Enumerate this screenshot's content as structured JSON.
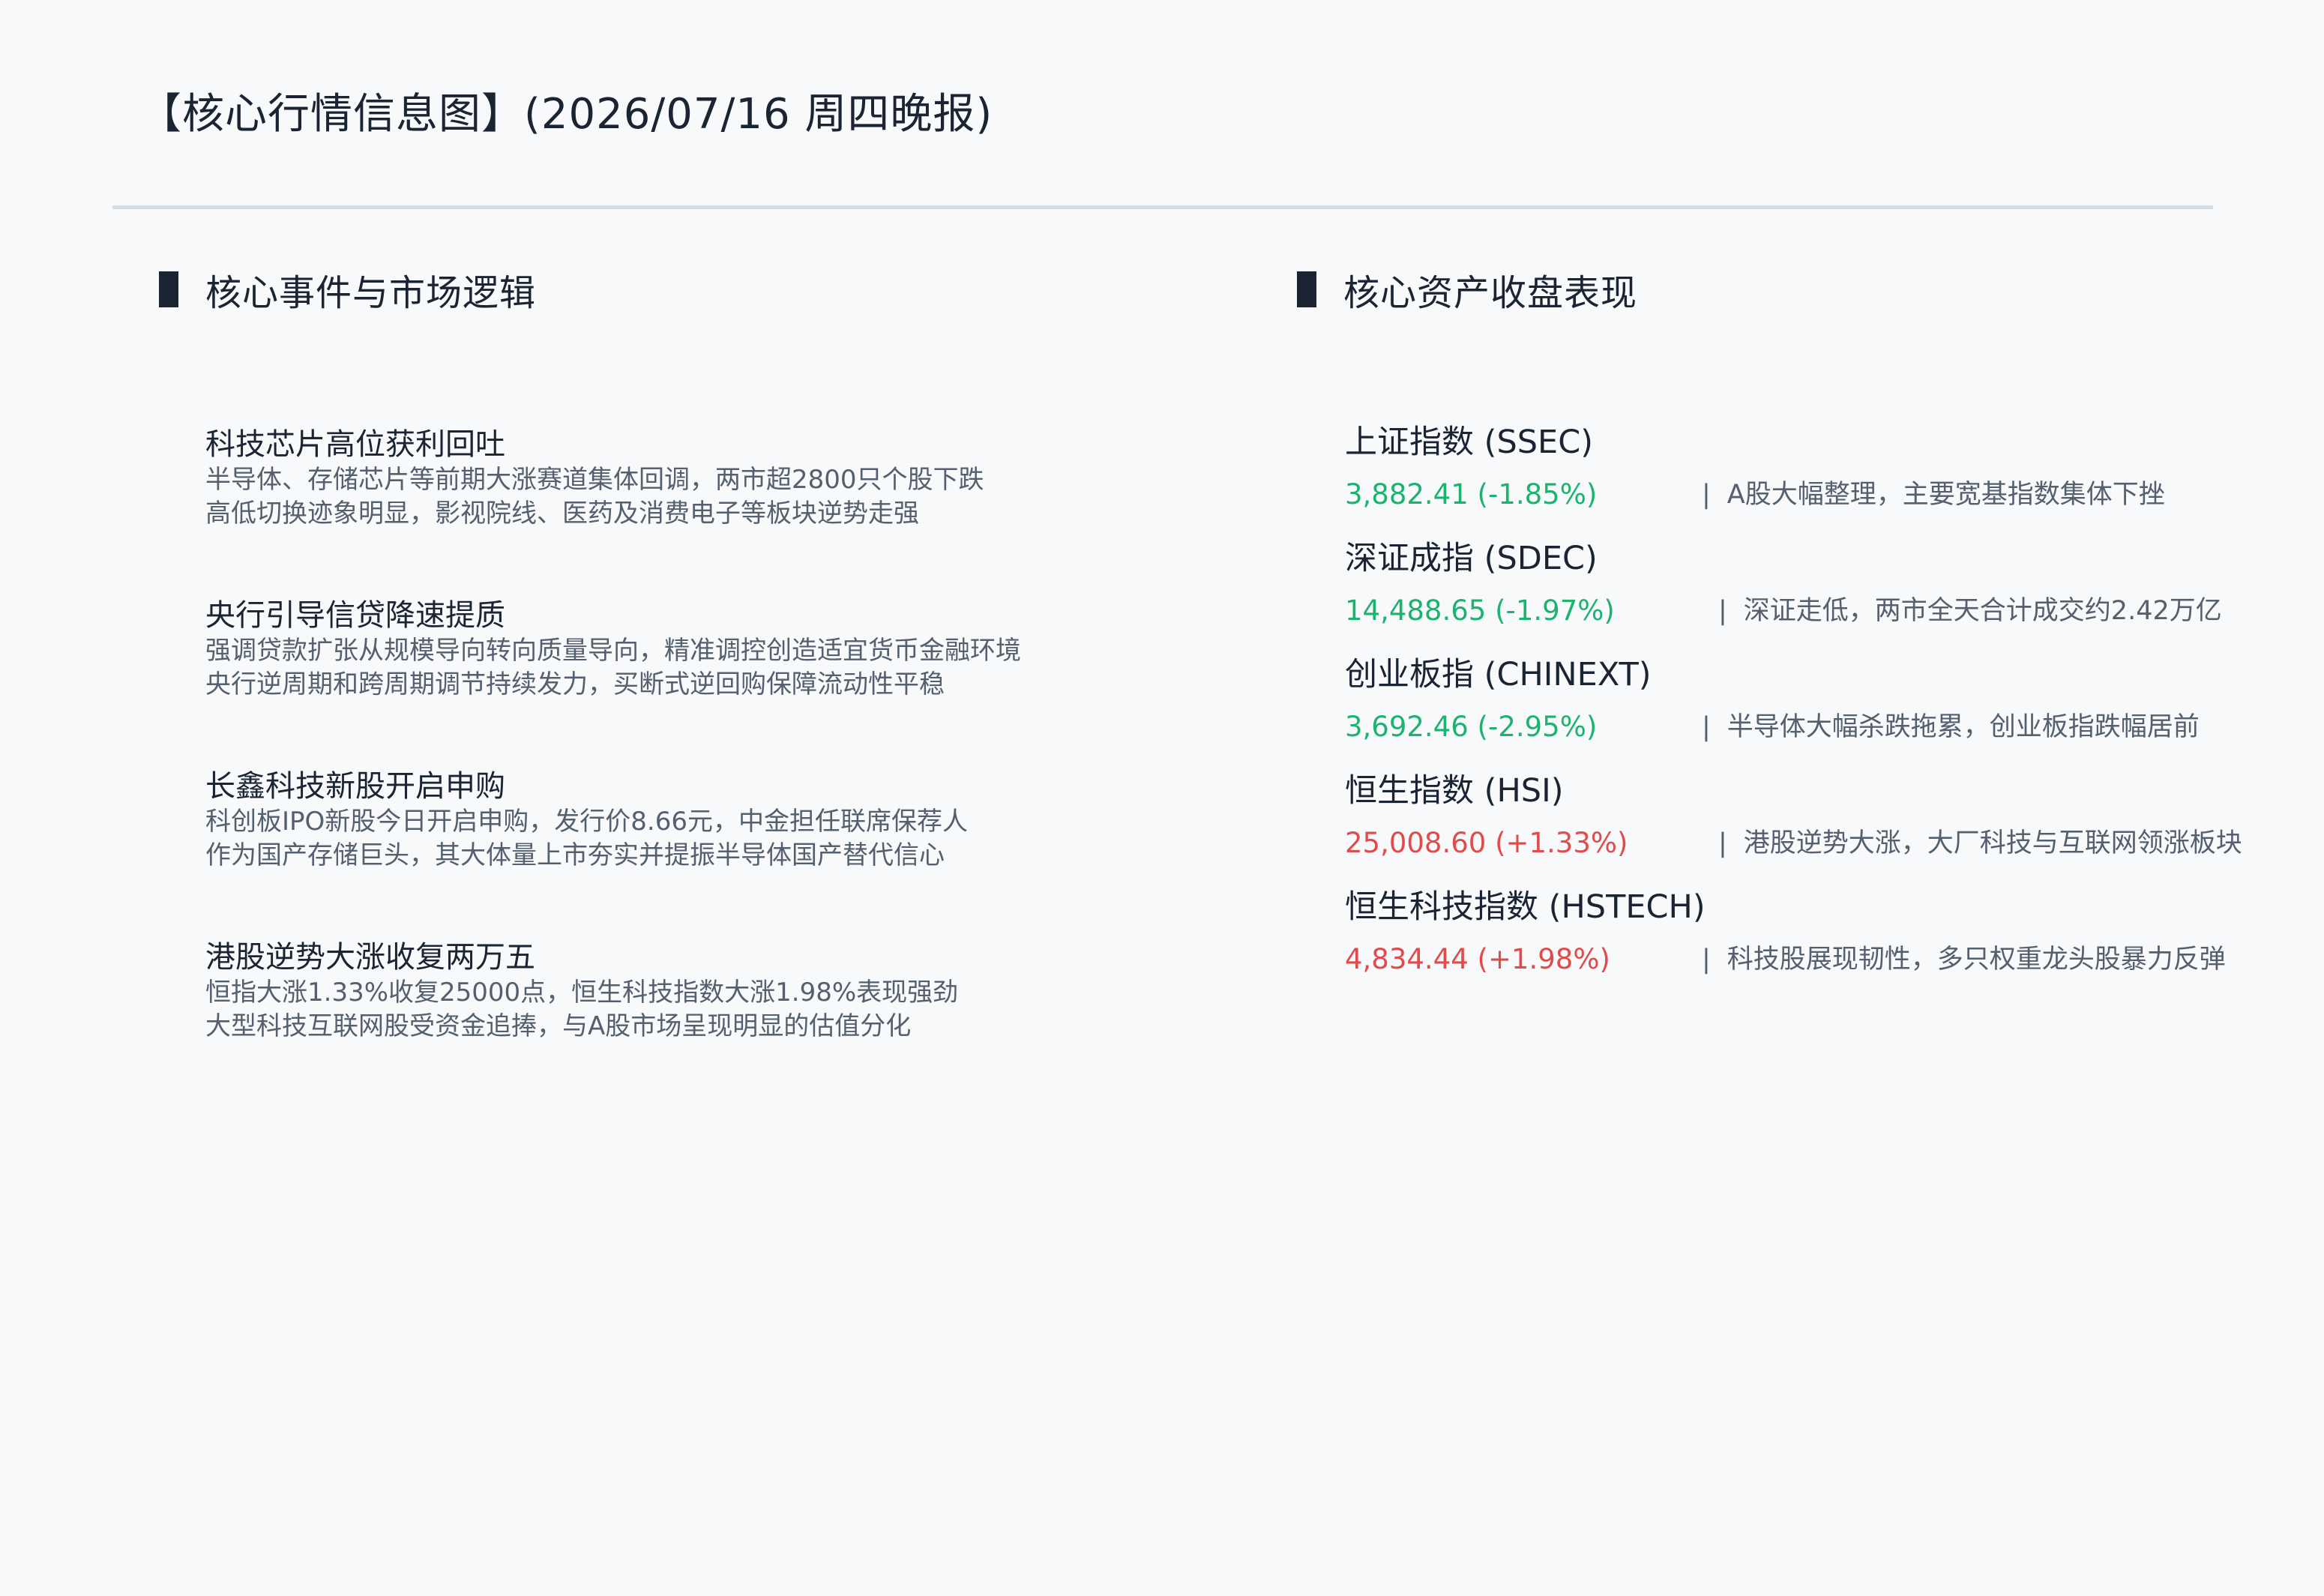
{
  "header": {
    "title": "【核心行情信息图】(2026/07/16 周四晚报)"
  },
  "events_section": {
    "title": "核心事件与市场逻辑",
    "items": [
      {
        "title": "科技芯片高位获利回吐",
        "lines": [
          "半导体、存储芯片等前期大涨赛道集体回调，两市超2800只个股下跌",
          "高低切换迹象明显，影视院线、医药及消费电子等板块逆势走强"
        ]
      },
      {
        "title": "央行引导信贷降速提质",
        "lines": [
          "强调贷款扩张从规模导向转向质量导向，精准调控创造适宜货币金融环境",
          "央行逆周期和跨周期调节持续发力，买断式逆回购保障流动性平稳"
        ]
      },
      {
        "title": "长鑫科技新股开启申购",
        "lines": [
          "科创板IPO新股今日开启申购，发行价8.66元，中金担任联席保荐人",
          "作为国产存储巨头，其大体量上市夯实并提振半导体国产替代信心"
        ]
      },
      {
        "title": "港股逆势大涨收复两万五",
        "lines": [
          "恒指大涨1.33%收复25000点，恒生科技指数大涨1.98%表现强劲",
          "大型科技互联网股受资金追捧，与A股市场呈现明显的估值分化"
        ]
      }
    ]
  },
  "assets_section": {
    "title": "核心资产收盘表现",
    "separator": "|",
    "colors": {
      "down": "#1db36f",
      "up": "#e04b4b"
    },
    "items": [
      {
        "name": "上证指数 (SSEC)",
        "value": "3,882.41 (-1.85%)",
        "direction": "down",
        "comment": "A股大幅整理，主要宽基指数集体下挫"
      },
      {
        "name": "深证成指 (SDEC)",
        "value": "14,488.65 (-1.97%)",
        "direction": "down",
        "comment": "深证走低，两市全天合计成交约2.42万亿"
      },
      {
        "name": "创业板指 (CHINEXT)",
        "value": "3,692.46 (-2.95%)",
        "direction": "down",
        "comment": "半导体大幅杀跌拖累，创业板指跌幅居前"
      },
      {
        "name": "恒生指数 (HSI)",
        "value": "25,008.60 (+1.33%)",
        "direction": "up",
        "comment": "港股逆势大涨，大厂科技与互联网领涨板块"
      },
      {
        "name": "恒生科技指数 (HSTECH)",
        "value": "4,834.44 (+1.98%)",
        "direction": "up",
        "comment": "科技股展现韧性，多只权重龙头股暴力反弹"
      }
    ]
  }
}
